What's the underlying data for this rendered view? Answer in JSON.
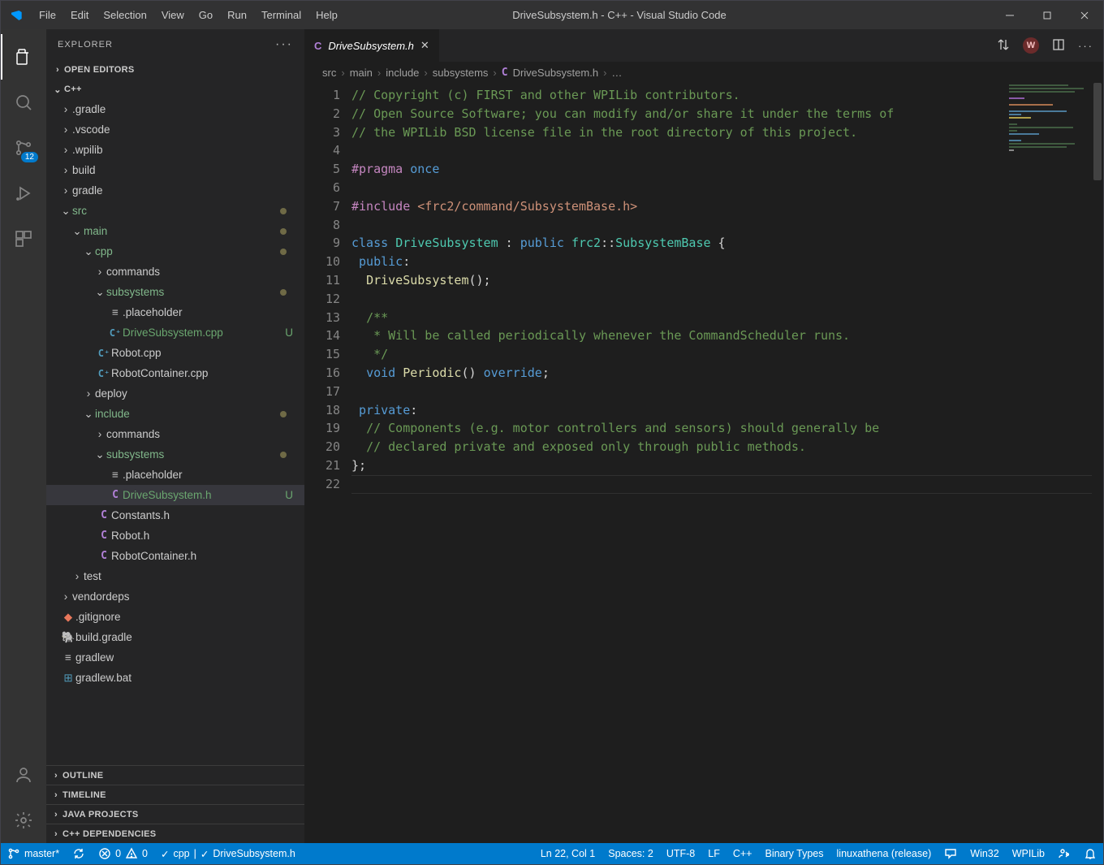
{
  "window_title": "DriveSubsystem.h - C++ - Visual Studio Code",
  "menus": [
    "File",
    "Edit",
    "Selection",
    "View",
    "Go",
    "Run",
    "Terminal",
    "Help"
  ],
  "activity": {
    "scm_badge": "12"
  },
  "explorer": {
    "title": "EXPLORER",
    "sections": {
      "open_editors": "OPEN EDITORS",
      "project": "C++",
      "outline": "OUTLINE",
      "timeline": "TIMELINE",
      "java": "JAVA PROJECTS",
      "cpp": "C++ DEPENDENCIES"
    },
    "tree": {
      "gradle_hidden": ".gradle",
      "vscode_hidden": ".vscode",
      "wpilib_hidden": ".wpilib",
      "build": "build",
      "gradle": "gradle",
      "src": "src",
      "main": "main",
      "cpp": "cpp",
      "commands": "commands",
      "subsystems": "subsystems",
      "placeholder": ".placeholder",
      "drive_cpp": "DriveSubsystem.cpp",
      "robot_cpp": "Robot.cpp",
      "robotcontainer_cpp": "RobotContainer.cpp",
      "deploy": "deploy",
      "include": "include",
      "commands2": "commands",
      "subsystems2": "subsystems",
      "placeholder2": ".placeholder",
      "drive_h": "DriveSubsystem.h",
      "constants_h": "Constants.h",
      "robot_h": "Robot.h",
      "robotcontainer_h": "RobotContainer.h",
      "test": "test",
      "vendordeps": "vendordeps",
      "gitignore": ".gitignore",
      "buildgradle": "build.gradle",
      "gradlew": "gradlew",
      "gradlewbat": "gradlew.bat"
    },
    "status_u": "U"
  },
  "tabs": {
    "active": {
      "icon": "C",
      "name": "DriveSubsystem.h"
    },
    "w_badge": "W"
  },
  "breadcrumbs": [
    "src",
    "main",
    "include",
    "subsystems",
    "DriveSubsystem.h",
    "…"
  ],
  "breadcrumb_icon": "C",
  "code_lines": [
    {
      "n": "1",
      "spans": [
        {
          "c": "c-comment",
          "t": "// Copyright (c) FIRST and other WPILib contributors."
        }
      ]
    },
    {
      "n": "2",
      "spans": [
        {
          "c": "c-comment",
          "t": "// Open Source Software; you can modify and/or share it under the terms of"
        }
      ]
    },
    {
      "n": "3",
      "spans": [
        {
          "c": "c-comment",
          "t": "// the WPILib BSD license file in the root directory of this project."
        }
      ]
    },
    {
      "n": "4",
      "spans": []
    },
    {
      "n": "5",
      "spans": [
        {
          "c": "c-preproc",
          "t": "#pragma"
        },
        {
          "c": "",
          "t": " "
        },
        {
          "c": "c-once",
          "t": "once"
        }
      ]
    },
    {
      "n": "6",
      "spans": []
    },
    {
      "n": "7",
      "spans": [
        {
          "c": "c-preproc",
          "t": "#include"
        },
        {
          "c": "",
          "t": " "
        },
        {
          "c": "c-string",
          "t": "<frc2/command/SubsystemBase.h>"
        }
      ]
    },
    {
      "n": "8",
      "spans": []
    },
    {
      "n": "9",
      "spans": [
        {
          "c": "c-keyword",
          "t": "class"
        },
        {
          "c": "",
          "t": " "
        },
        {
          "c": "c-type",
          "t": "DriveSubsystem"
        },
        {
          "c": "",
          "t": " : "
        },
        {
          "c": "c-keyword",
          "t": "public"
        },
        {
          "c": "",
          "t": " "
        },
        {
          "c": "c-type",
          "t": "frc2"
        },
        {
          "c": "",
          "t": "::"
        },
        {
          "c": "c-type",
          "t": "SubsystemBase"
        },
        {
          "c": "",
          "t": " {"
        }
      ]
    },
    {
      "n": "10",
      "spans": [
        {
          "c": "",
          "t": " "
        },
        {
          "c": "c-keyword",
          "t": "public"
        },
        {
          "c": "",
          "t": ":"
        }
      ]
    },
    {
      "n": "11",
      "spans": [
        {
          "c": "",
          "t": "  "
        },
        {
          "c": "c-func",
          "t": "DriveSubsystem"
        },
        {
          "c": "",
          "t": "();"
        }
      ]
    },
    {
      "n": "12",
      "spans": []
    },
    {
      "n": "13",
      "spans": [
        {
          "c": "",
          "t": "  "
        },
        {
          "c": "c-comment",
          "t": "/**"
        }
      ]
    },
    {
      "n": "14",
      "spans": [
        {
          "c": "",
          "t": "  "
        },
        {
          "c": "c-comment",
          "t": " * Will be called periodically whenever the CommandScheduler runs."
        }
      ]
    },
    {
      "n": "15",
      "spans": [
        {
          "c": "",
          "t": "  "
        },
        {
          "c": "c-comment",
          "t": " */"
        }
      ]
    },
    {
      "n": "16",
      "spans": [
        {
          "c": "",
          "t": "  "
        },
        {
          "c": "c-keyword",
          "t": "void"
        },
        {
          "c": "",
          "t": " "
        },
        {
          "c": "c-func",
          "t": "Periodic"
        },
        {
          "c": "",
          "t": "() "
        },
        {
          "c": "c-keyword",
          "t": "override"
        },
        {
          "c": "",
          "t": ";"
        }
      ]
    },
    {
      "n": "17",
      "spans": []
    },
    {
      "n": "18",
      "spans": [
        {
          "c": "",
          "t": " "
        },
        {
          "c": "c-keyword",
          "t": "private"
        },
        {
          "c": "",
          "t": ":"
        }
      ]
    },
    {
      "n": "19",
      "spans": [
        {
          "c": "",
          "t": "  "
        },
        {
          "c": "c-comment",
          "t": "// Components (e.g. motor controllers and sensors) should generally be"
        }
      ]
    },
    {
      "n": "20",
      "spans": [
        {
          "c": "",
          "t": "  "
        },
        {
          "c": "c-comment",
          "t": "// declared private and exposed only through public methods."
        }
      ]
    },
    {
      "n": "21",
      "spans": [
        {
          "c": "",
          "t": "};"
        }
      ]
    },
    {
      "n": "22",
      "spans": [],
      "current": true
    }
  ],
  "status": {
    "branch": "master*",
    "errors": "0",
    "warnings": "0",
    "lang_check": "cpp",
    "file_check": "DriveSubsystem.h",
    "lncol": "Ln 22, Col 1",
    "spaces": "Spaces: 2",
    "encoding": "UTF-8",
    "eol": "LF",
    "lang": "C++",
    "binary": "Binary Types",
    "target": "linuxathena (release)",
    "platform": "Win32",
    "wpilib": "WPILib"
  }
}
